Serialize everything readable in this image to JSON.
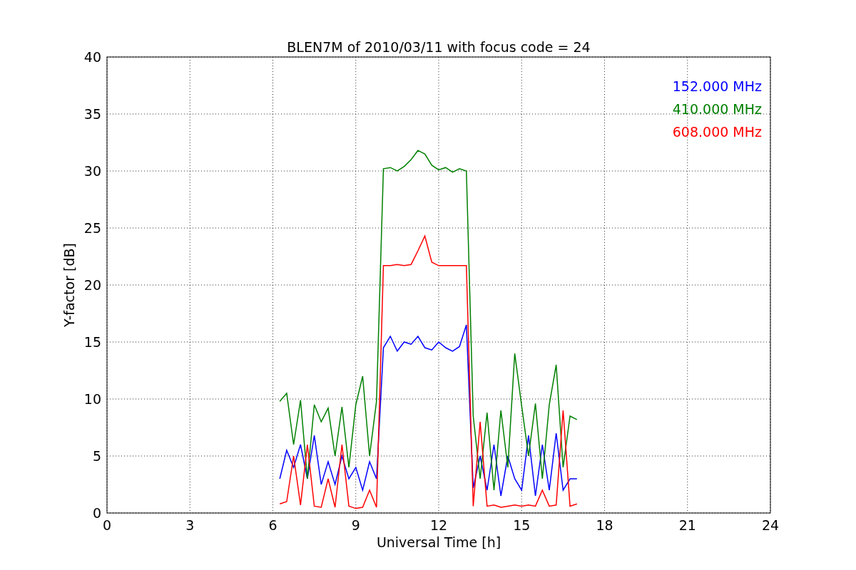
{
  "chart_data": {
    "type": "line",
    "title": "BLEN7M of 2010/03/11 with focus code = 24",
    "xlabel": "Universal Time [h]",
    "ylabel": "Y-factor [dB]",
    "xlim": [
      0,
      24
    ],
    "ylim": [
      0,
      40
    ],
    "xticks": [
      0,
      3,
      6,
      9,
      12,
      15,
      18,
      21,
      24
    ],
    "yticks": [
      0,
      5,
      10,
      15,
      20,
      25,
      30,
      35,
      40
    ],
    "grid": true,
    "x": [
      6.25,
      6.5,
      6.75,
      7,
      7.25,
      7.5,
      7.75,
      8,
      8.25,
      8.5,
      8.75,
      9,
      9.25,
      9.5,
      9.75,
      10,
      10.25,
      10.5,
      10.75,
      11,
      11.25,
      11.5,
      11.75,
      12,
      12.25,
      12.5,
      12.75,
      13,
      13.25,
      13.5,
      13.75,
      14,
      14.25,
      14.5,
      14.75,
      15,
      15.25,
      15.5,
      15.75,
      16,
      16.25,
      16.5,
      16.75,
      17
    ],
    "series": [
      {
        "name": "152.000 MHz",
        "color": "#0000ff",
        "values": [
          3,
          5.5,
          4,
          6,
          3,
          6.8,
          2.5,
          4.5,
          2.5,
          5,
          3,
          4,
          2,
          4.5,
          3,
          14.5,
          15.5,
          14.2,
          15,
          14.8,
          15.5,
          14.5,
          14.3,
          15,
          14.5,
          14.2,
          14.6,
          16.5,
          2.2,
          5,
          2,
          6,
          1.5,
          5,
          3,
          2,
          6.8,
          1.5,
          6,
          2,
          7,
          2,
          3,
          3
        ]
      },
      {
        "name": "410.000 MHz",
        "color": "#008000",
        "values": [
          9.8,
          10.5,
          6,
          9.9,
          3,
          9.5,
          8,
          9.2,
          5,
          9.3,
          4,
          9.5,
          12,
          5,
          9.8,
          30.2,
          30.3,
          30,
          30.4,
          31,
          31.8,
          31.5,
          30.5,
          30.1,
          30.3,
          29.9,
          30.2,
          30,
          8.5,
          3,
          8.8,
          2,
          9,
          4,
          14,
          9.4,
          5,
          9.6,
          3,
          9.5,
          13,
          4,
          8.5,
          8.2
        ]
      },
      {
        "name": "608.000 MHz",
        "color": "#ff0000",
        "values": [
          0.8,
          1,
          5,
          0.7,
          6,
          0.6,
          0.5,
          3,
          0.5,
          6,
          0.6,
          0.4,
          0.5,
          2,
          0.5,
          21.7,
          21.7,
          21.8,
          21.7,
          21.8,
          23,
          24.3,
          22,
          21.7,
          21.7,
          21.7,
          21.7,
          21.7,
          0.6,
          8,
          0.6,
          0.7,
          0.5,
          0.6,
          0.7,
          0.6,
          0.7,
          0.6,
          2,
          0.6,
          0.7,
          9,
          0.6,
          0.8
        ]
      }
    ]
  }
}
